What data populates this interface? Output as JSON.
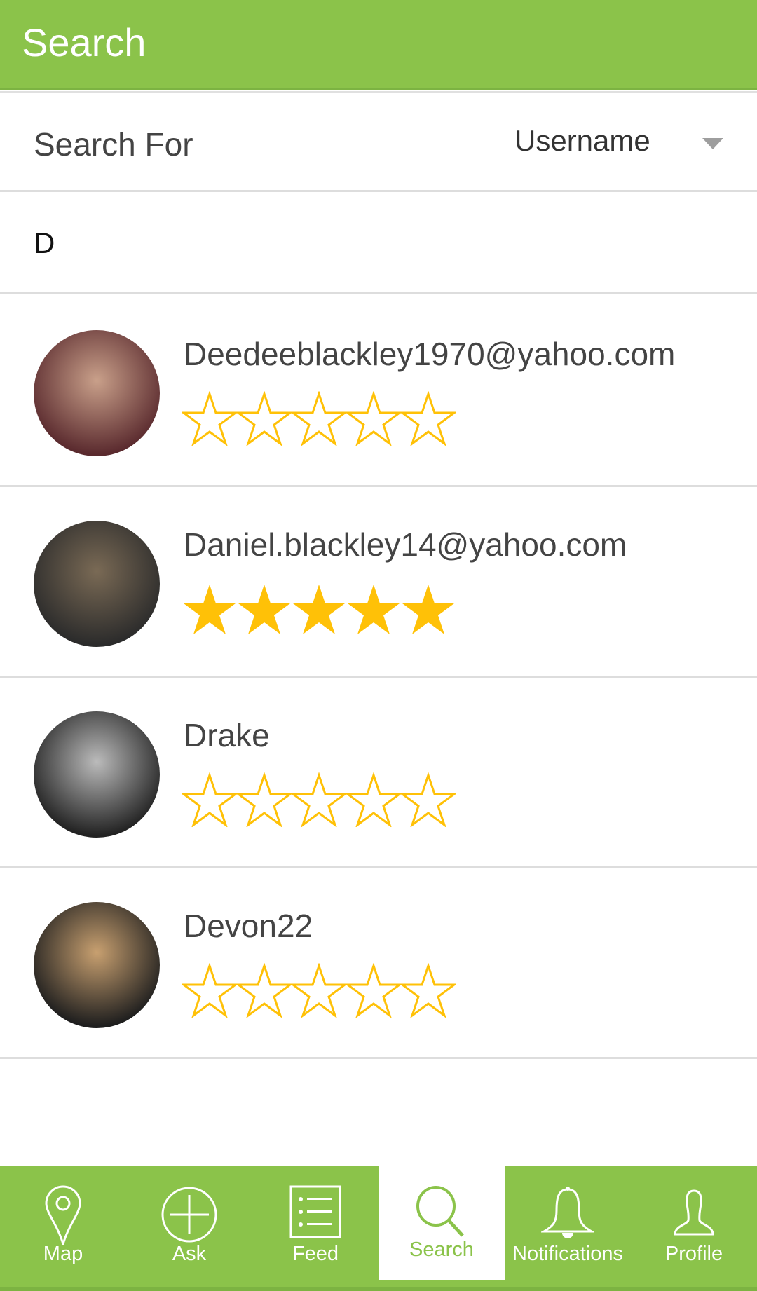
{
  "header": {
    "title": "Search"
  },
  "search_for": {
    "label": "Search For",
    "selected": "Username"
  },
  "search_input": {
    "value": "D",
    "placeholder": ""
  },
  "results": [
    {
      "name": "Deedeeblackley1970@yahoo.com",
      "rating": 0,
      "avatar_colors": [
        "#5a2a2e",
        "#c9a08a"
      ]
    },
    {
      "name": "Daniel.blackley14@yahoo.com",
      "rating": 5,
      "avatar_colors": [
        "#2b2b2b",
        "#7a6a55"
      ]
    },
    {
      "name": "Drake",
      "rating": 0,
      "avatar_colors": [
        "#222222",
        "#bbbbbb"
      ]
    },
    {
      "name": "Devon22",
      "rating": 0,
      "avatar_colors": [
        "#1e1e1e",
        "#c8a070"
      ]
    }
  ],
  "nav": {
    "map": "Map",
    "ask": "Ask",
    "feed": "Feed",
    "search": "Search",
    "notifications": "Notifications",
    "profile": "Profile"
  },
  "colors": {
    "brand": "#8bc34a",
    "star": "#ffc107"
  }
}
